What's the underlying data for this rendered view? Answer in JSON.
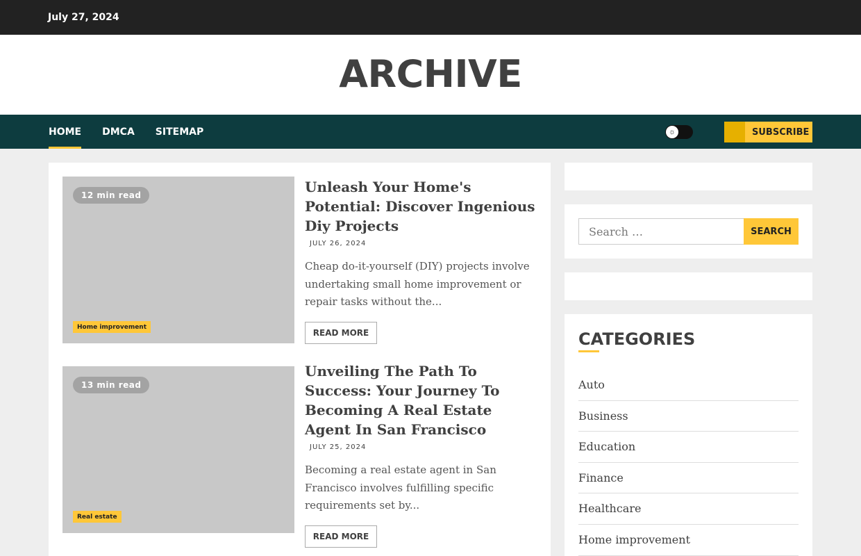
{
  "topbar": {
    "date": "July 27, 2024"
  },
  "site": {
    "title": "ARCHIVE"
  },
  "nav": {
    "items": [
      {
        "label": "HOME",
        "active": true
      },
      {
        "label": "DMCA",
        "active": false
      },
      {
        "label": "SITEMAP",
        "active": false
      }
    ],
    "subscribe_label": "SUBSCRIBE",
    "theme_toggle_icon": "sun-icon"
  },
  "posts": [
    {
      "read_time": "12 min read",
      "category": "Home improvement",
      "title": "Unleash Your Home's Potential: Discover Ingenious Diy Projects",
      "date": "JULY 26, 2024",
      "excerpt": "Cheap do-it-yourself (DIY) projects involve undertaking small home improvement or repair tasks without the...",
      "read_more": "READ MORE"
    },
    {
      "read_time": "13 min read",
      "category": "Real estate",
      "title": "Unveiling The Path To Success: Your Journey To Becoming A Real Estate Agent In San Francisco",
      "date": "JULY 25, 2024",
      "excerpt": "Becoming a real estate agent in San Francisco involves fulfilling specific requirements set by...",
      "read_more": "READ MORE"
    }
  ],
  "sidebar": {
    "search": {
      "placeholder": "Search …",
      "button": "SEARCH"
    },
    "categories": {
      "title": "CATEGORIES",
      "items": [
        "Auto",
        "Business",
        "Education",
        "Finance",
        "Healthcare",
        "Home improvement"
      ]
    }
  },
  "colors": {
    "accent": "#ffc738",
    "nav_bg": "#0d3c3f",
    "topbar_bg": "#222222",
    "page_bg": "#eeeeee"
  }
}
